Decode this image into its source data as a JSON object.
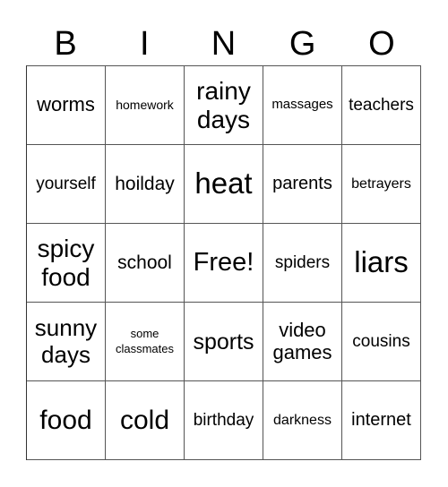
{
  "header": {
    "letters": [
      "B",
      "I",
      "N",
      "G",
      "O"
    ]
  },
  "card": {
    "rows": [
      [
        "worms",
        "homework",
        "rainy days",
        "massages",
        "teachers"
      ],
      [
        "yourself",
        "hoilday",
        "heat",
        "parents",
        "betrayers"
      ],
      [
        "spicy food",
        "school",
        "Free!",
        "spiders",
        "liars"
      ],
      [
        "sunny days",
        "some classmates",
        "sports",
        "video games",
        "cousins"
      ],
      [
        "food",
        "cold",
        "birthday",
        "darkness",
        "internet"
      ]
    ],
    "free_space": "Free!"
  },
  "colors": {
    "background": "#ffffff",
    "text": "#000000",
    "grid_lines": "#555555"
  }
}
